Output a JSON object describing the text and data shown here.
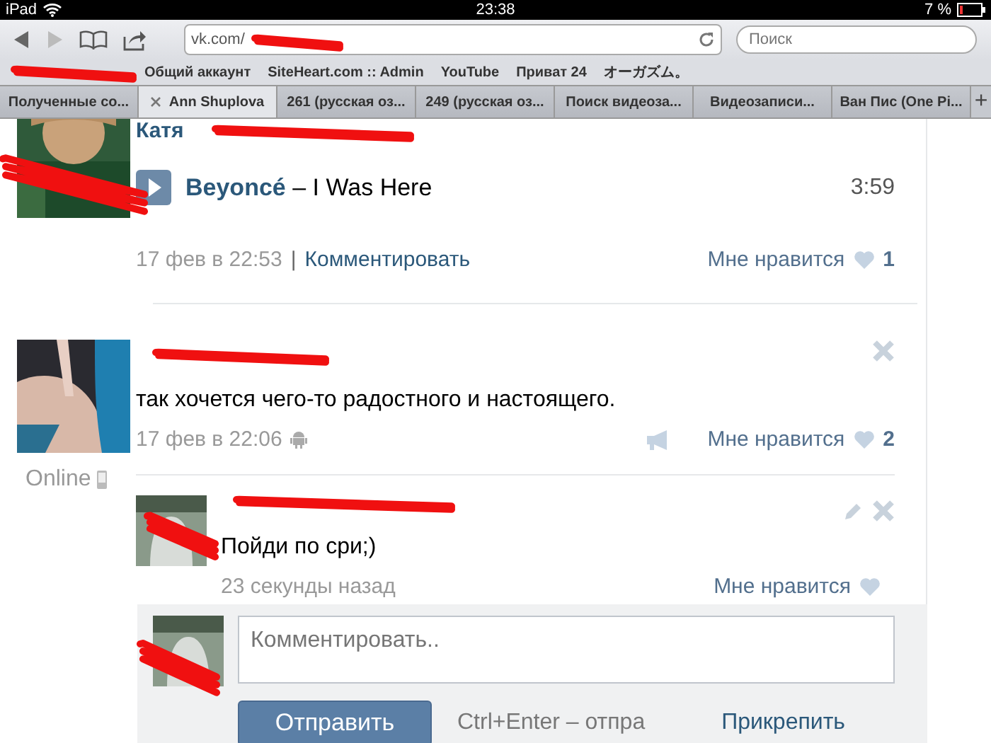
{
  "status_bar": {
    "device": "iPad",
    "time": "23:38",
    "battery": "7 %"
  },
  "toolbar": {
    "back_disabled": false,
    "forward_disabled": true,
    "url": "vk.com/",
    "search": {
      "placeholder": "Поиск"
    }
  },
  "bookmarks": [
    "Общий аккаунт",
    "SiteHeart.com :: Admin",
    "YouTube",
    "Приват 24",
    "オーガズム。"
  ],
  "tabs": [
    {
      "label": "Полученные со...",
      "selected": false
    },
    {
      "label": "Ann Shuplova",
      "selected": true
    },
    {
      "label": "261 (русская оз...",
      "selected": false
    },
    {
      "label": "249 (русская оз...",
      "selected": false
    },
    {
      "label": "Поиск видеоза...",
      "selected": false
    },
    {
      "label": "Видеозаписи...",
      "selected": false
    },
    {
      "label": "Ван Пис (One Pi...",
      "selected": false
    }
  ],
  "new_tab": "+",
  "posts": [
    {
      "author": "Катя",
      "audio": {
        "artist": "Beyoncé",
        "title": "– I Was Here",
        "duration": "3:59"
      },
      "date": "17 фев в 22:53",
      "separator": "|",
      "comment_link": "Комментировать",
      "like": "Мне нравится",
      "like_count": "1"
    },
    {
      "text": "так хочется чего-то радостного и настоящего.",
      "date": "17 фев в 22:06",
      "like": "Мне нравится",
      "like_count": "2",
      "status": "Online",
      "comments": [
        {
          "text": "Пойди по сри;)",
          "time": "23 секунды назад",
          "like": "Мне нравится"
        }
      ],
      "reply": {
        "placeholder": "Комментировать..",
        "send": "Отправить",
        "hint": "Ctrl+Enter – отпра",
        "attach": "Прикрепить"
      }
    }
  ]
}
